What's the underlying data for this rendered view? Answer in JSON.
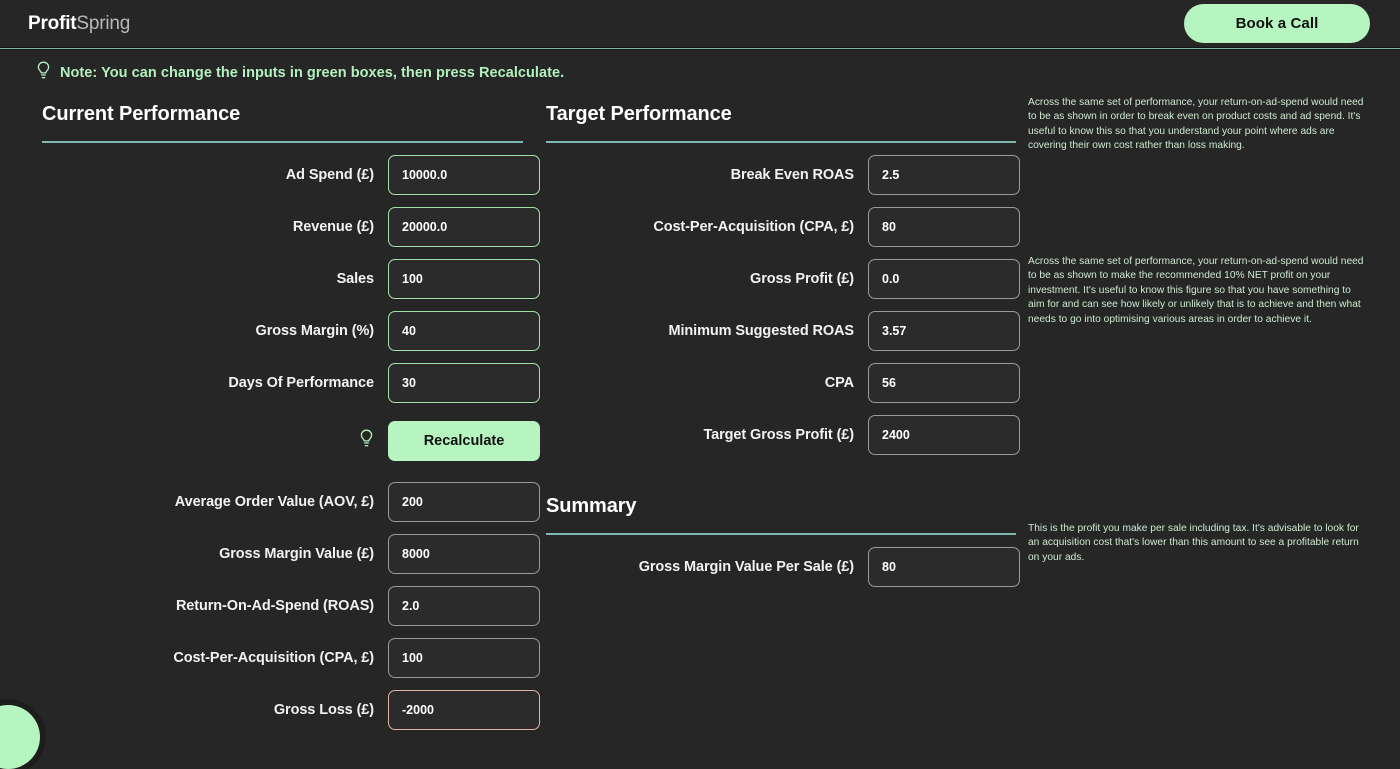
{
  "header": {
    "logo_bold": "Profit",
    "logo_light": "Spring",
    "book_call_label": "Book a Call",
    "accent_green": "#b6f5c0",
    "rule_color": "#7fb8ae"
  },
  "note": {
    "icon": "lightbulb-icon",
    "text": "Note: You can change the inputs in green boxes, then press Recalculate."
  },
  "current_performance": {
    "title": "Current Performance",
    "fields": [
      {
        "label": "Ad Spend (£)",
        "value": "10000.0",
        "state": "editable"
      },
      {
        "label": "Revenue (£)",
        "value": "20000.0",
        "state": "editable"
      },
      {
        "label": "Sales",
        "value": "100",
        "state": "editable"
      },
      {
        "label": "Gross Margin (%)",
        "value": "40",
        "state": "editable"
      },
      {
        "label": "Days Of Performance",
        "value": "30",
        "state": "editable"
      }
    ],
    "recalculate_label": "Recalculate",
    "recalculate_icon": "lightbulb-icon",
    "derived_fields": [
      {
        "label": "Average Order Value (AOV, £)",
        "value": "200",
        "state": "readonly"
      },
      {
        "label": "Gross Margin Value (£)",
        "value": "8000",
        "state": "readonly"
      },
      {
        "label": "Return-On-Ad-Spend (ROAS)",
        "value": "2.0",
        "state": "readonly"
      },
      {
        "label": "Cost-Per-Acquisition (CPA, £)",
        "value": "100",
        "state": "readonly"
      },
      {
        "label": "Gross Loss (£)",
        "value": "-2000",
        "state": "negative"
      }
    ]
  },
  "target_performance": {
    "title": "Target Performance",
    "fields": [
      {
        "label": "Break Even ROAS",
        "value": "2.5",
        "state": "readonly"
      },
      {
        "label": "Cost-Per-Acquisition (CPA, £)",
        "value": "80",
        "state": "readonly"
      },
      {
        "label": "Gross Profit (£)",
        "value": "0.0",
        "state": "readonly"
      },
      {
        "label": "Minimum Suggested ROAS",
        "value": "3.57",
        "state": "readonly"
      },
      {
        "label": "CPA",
        "value": "56",
        "state": "readonly"
      },
      {
        "label": "Target Gross Profit (£)",
        "value": "2400",
        "state": "readonly"
      }
    ]
  },
  "summary": {
    "title": "Summary",
    "fields": [
      {
        "label": "Gross Margin Value Per Sale (£)",
        "value": "80",
        "state": "readonly"
      }
    ]
  },
  "help": {
    "break_even_roas": "Across the same set of performance, your return-on-ad-spend would need to be as shown in order to break even on product costs and ad spend. It's useful to know this so that you understand your point where ads are covering their own cost rather than loss making.",
    "minimum_suggested_roas": "Across the same set of performance, your return-on-ad-spend would need to be as shown to make the recommended 10% NET profit on your investment. It's useful to know this figure so that you have something to aim for and can see how likely or unlikely that is to achieve and then what needs to go into optimising various areas in order to achieve it.",
    "gross_margin_per_sale": "This is the profit you make per sale including tax. It's advisable to look for an acquisition cost that's lower than this amount to see a profitable return on your ads."
  }
}
